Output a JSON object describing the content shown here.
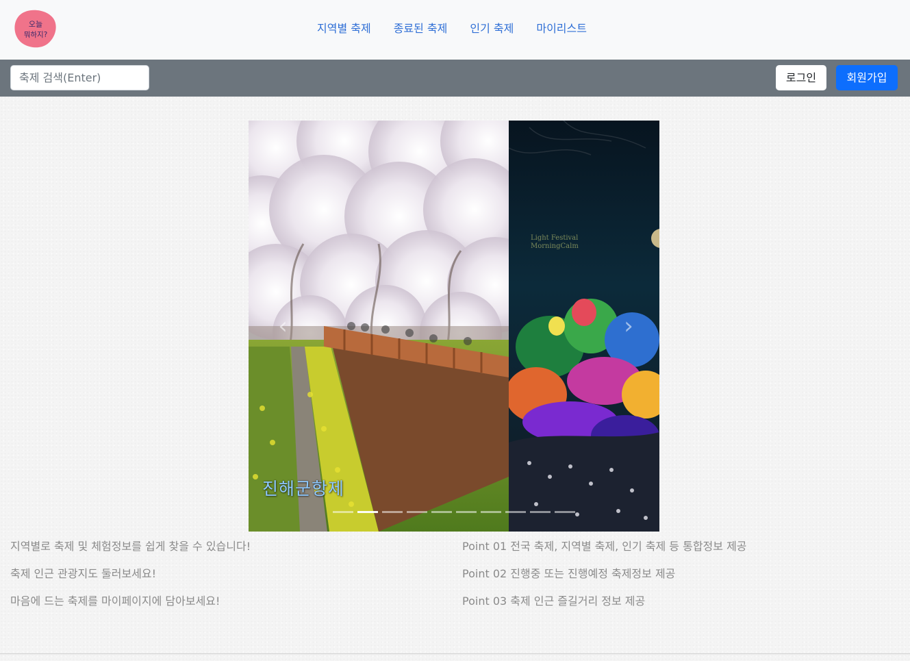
{
  "header": {
    "logo_text_line1": "오늘",
    "logo_text_line2": "뭐하지?",
    "nav": [
      "지역별 축제",
      "종료된 축제",
      "인기 축제",
      "마이리스트"
    ]
  },
  "toolbar": {
    "search_placeholder": "축제 검색(Enter)",
    "login_label": "로그인",
    "signup_label": "회원가입"
  },
  "carousel": {
    "caption": "진해군항제",
    "second_slide_text_line1": "Light Festival",
    "second_slide_text_line2": "MorningCalm",
    "slide_count": 10,
    "active_index": 1
  },
  "info_left": [
    "지역별로 축제 및 체험정보를 쉽게 찾을 수 있습니다!",
    "축제 인근 관광지도 둘러보세요!",
    "마음에 드는 축제를 마이페이지에 담아보세요!"
  ],
  "info_right": [
    "Point 01 전국 축제, 지역별 축제, 인기 축제 등 통합정보 제공",
    "Point 02 진행중 또는 진행예정 축제정보 제공",
    "Point 03 축제 인근 즐길거리 정보 제공"
  ],
  "colors": {
    "nav_link": "#2f6fd6",
    "toolbar_bg": "#6c757d",
    "signup_bg": "#0d6efd",
    "logo_bg": "#f0738a"
  }
}
